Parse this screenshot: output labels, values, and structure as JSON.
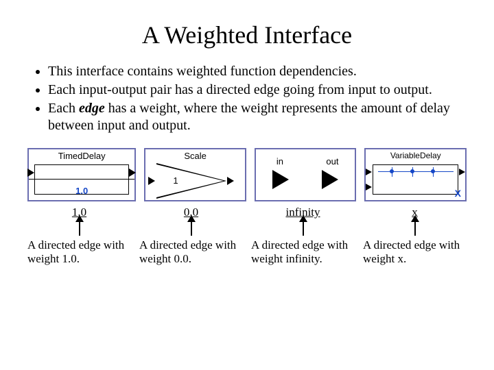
{
  "title": "A Weighted Interface",
  "bullets": [
    "This interface contains weighted function dependencies.",
    "Each input-output pair has a directed edge going from input to output.",
    "Each <edge> has a weight, where the weight represents the amount of delay between input and output."
  ],
  "bullet3_pre": "Each ",
  "bullet3_em": "edge",
  "bullet3_post": " has a weight, where the weight represents the amount of delay between input and output.",
  "diagrams": {
    "timed_delay": {
      "label": "TimedDelay",
      "value": "1.0"
    },
    "scale": {
      "label": "Scale",
      "value": "1"
    },
    "inout": {
      "in_label": "in",
      "out_label": "out"
    },
    "variable_delay": {
      "label": "VariableDelay",
      "param": "X"
    }
  },
  "weights": [
    "1.0",
    "0.0",
    "infinity",
    "x"
  ],
  "captions": [
    "A directed edge with weight 1.0.",
    "A directed edge with weight 0.0.",
    "A directed edge with weight infinity.",
    "A directed edge with weight x."
  ]
}
